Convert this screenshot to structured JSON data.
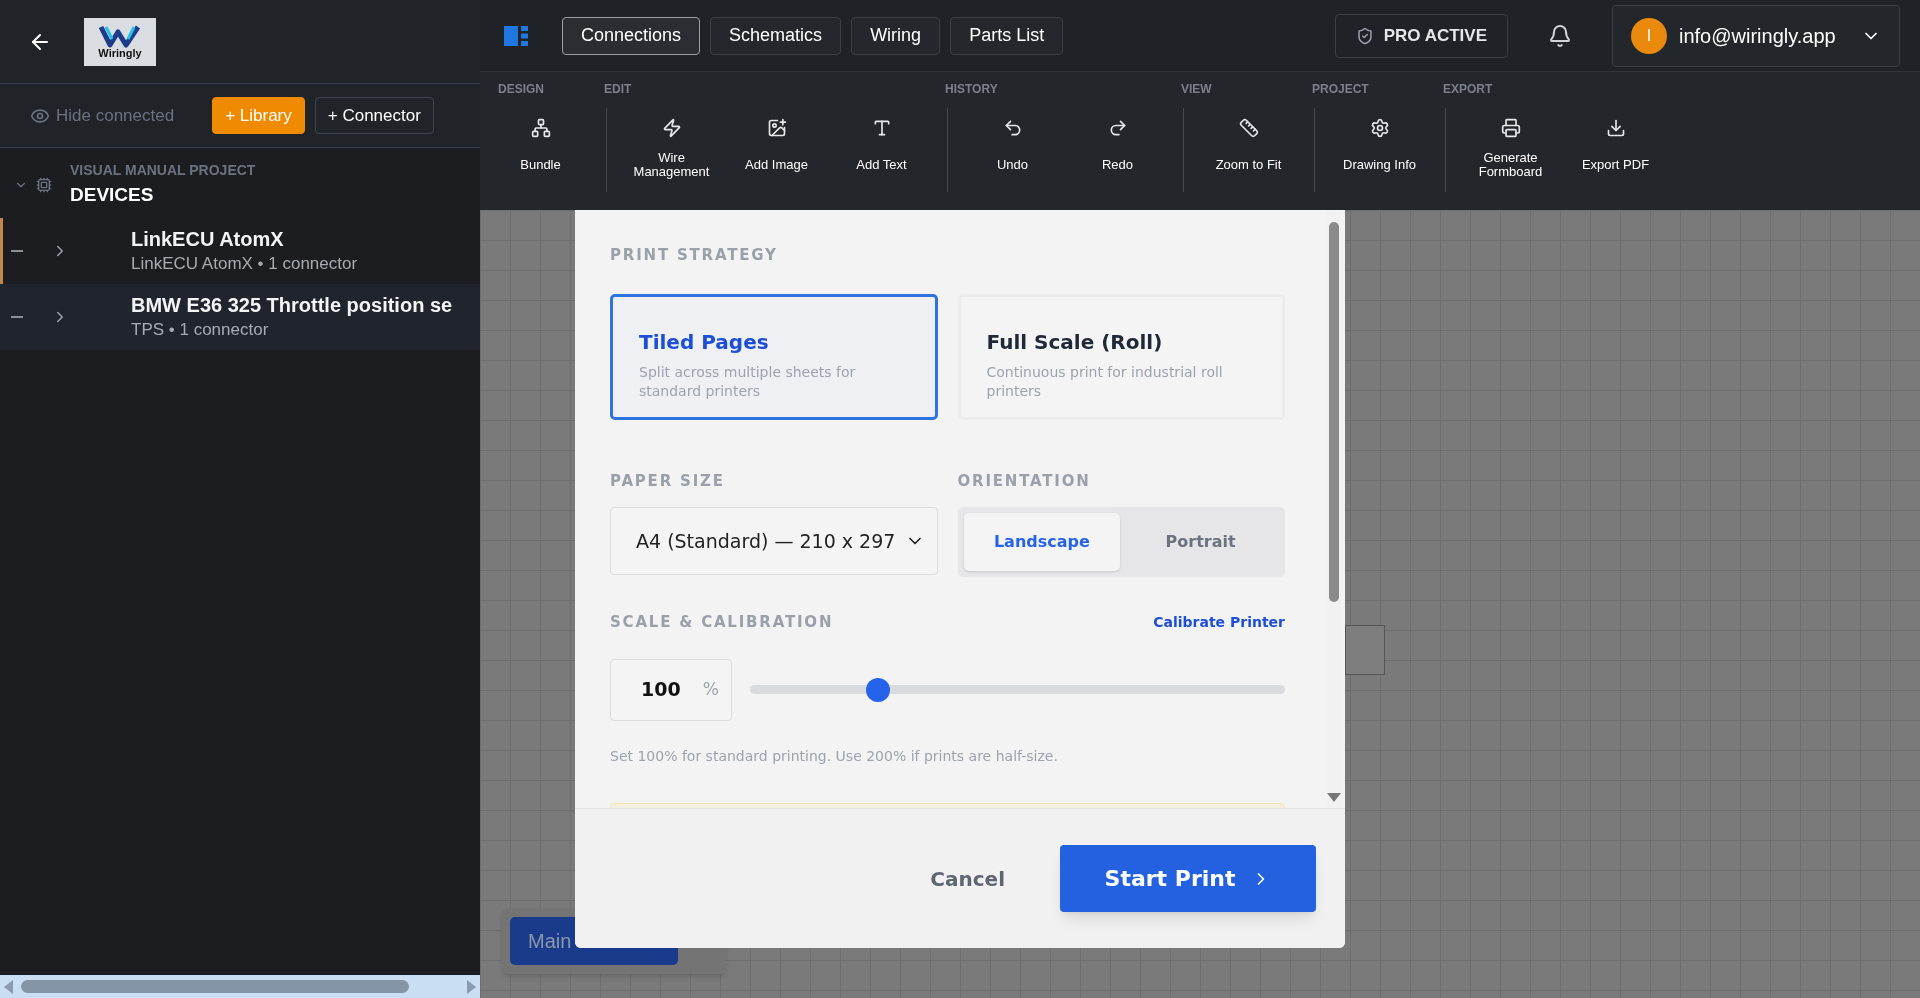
{
  "sidebar": {
    "logo_text": "Wiringly",
    "hide_connected": "Hide connected",
    "buttons": [
      {
        "label": "+ Library",
        "kind": "primary"
      },
      {
        "label": "+ Connector",
        "kind": "outline"
      }
    ],
    "tree": {
      "project": "VISUAL MANUAL PROJECT",
      "title": "DEVICES",
      "expanded": true,
      "items": [
        {
          "name": "LinkECU AtomX",
          "detail": "LinkECU AtomX • 1 connector",
          "selected": true
        },
        {
          "name": "BMW E36 325 Throttle position se",
          "detail": "TPS • 1 connector",
          "selected": false
        }
      ]
    }
  },
  "header": {
    "tabs": [
      {
        "label": "Connections",
        "selected": true
      },
      {
        "label": "Schematics",
        "selected": false
      },
      {
        "label": "Wiring",
        "selected": false
      },
      {
        "label": "Parts List",
        "selected": false
      }
    ],
    "pro_badge": "PRO ACTIVE",
    "user": {
      "initial": "I",
      "email": "info@wiringly.app"
    }
  },
  "toolbar": {
    "groups": [
      {
        "label": "DESIGN",
        "tools": [
          "Bundle"
        ]
      },
      {
        "label": "EDIT",
        "tools": [
          "Wire Management",
          "Add Image",
          "Add Text"
        ]
      },
      {
        "label": "HISTORY",
        "tools": [
          "Undo",
          "Redo"
        ]
      },
      {
        "label": "VIEW",
        "tools": [
          "Zoom to Fit"
        ]
      },
      {
        "label": "PROJECT",
        "tools": [
          "Drawing Info"
        ]
      },
      {
        "label": "EXPORT",
        "tools": [
          "Generate Formboard",
          "Export PDF"
        ]
      }
    ]
  },
  "canvas": {
    "harness_tab": "Main"
  },
  "print_dialog": {
    "strategy": {
      "label": "PRINT STRATEGY",
      "options": [
        {
          "title": "Tiled Pages",
          "description": "Split across multiple sheets for standard printers",
          "selected": true
        },
        {
          "title": "Full Scale (Roll)",
          "description": "Continuous print for industrial roll printers",
          "selected": false
        }
      ]
    },
    "paper_size": {
      "label": "PAPER SIZE",
      "value": "A4 (Standard) — 210 x 297"
    },
    "orientation": {
      "label": "ORIENTATION",
      "options": [
        {
          "label": "Landscape",
          "selected": true
        },
        {
          "label": "Portrait",
          "selected": false
        }
      ]
    },
    "scale": {
      "label": "SCALE & CALIBRATION",
      "link": "Calibrate Printer",
      "value": "100",
      "unit": "%",
      "level": 0.24,
      "hint": "Set 100% for standard printing. Use 200% if prints are half-size."
    },
    "cancel": "Cancel",
    "start": "Start Print"
  }
}
